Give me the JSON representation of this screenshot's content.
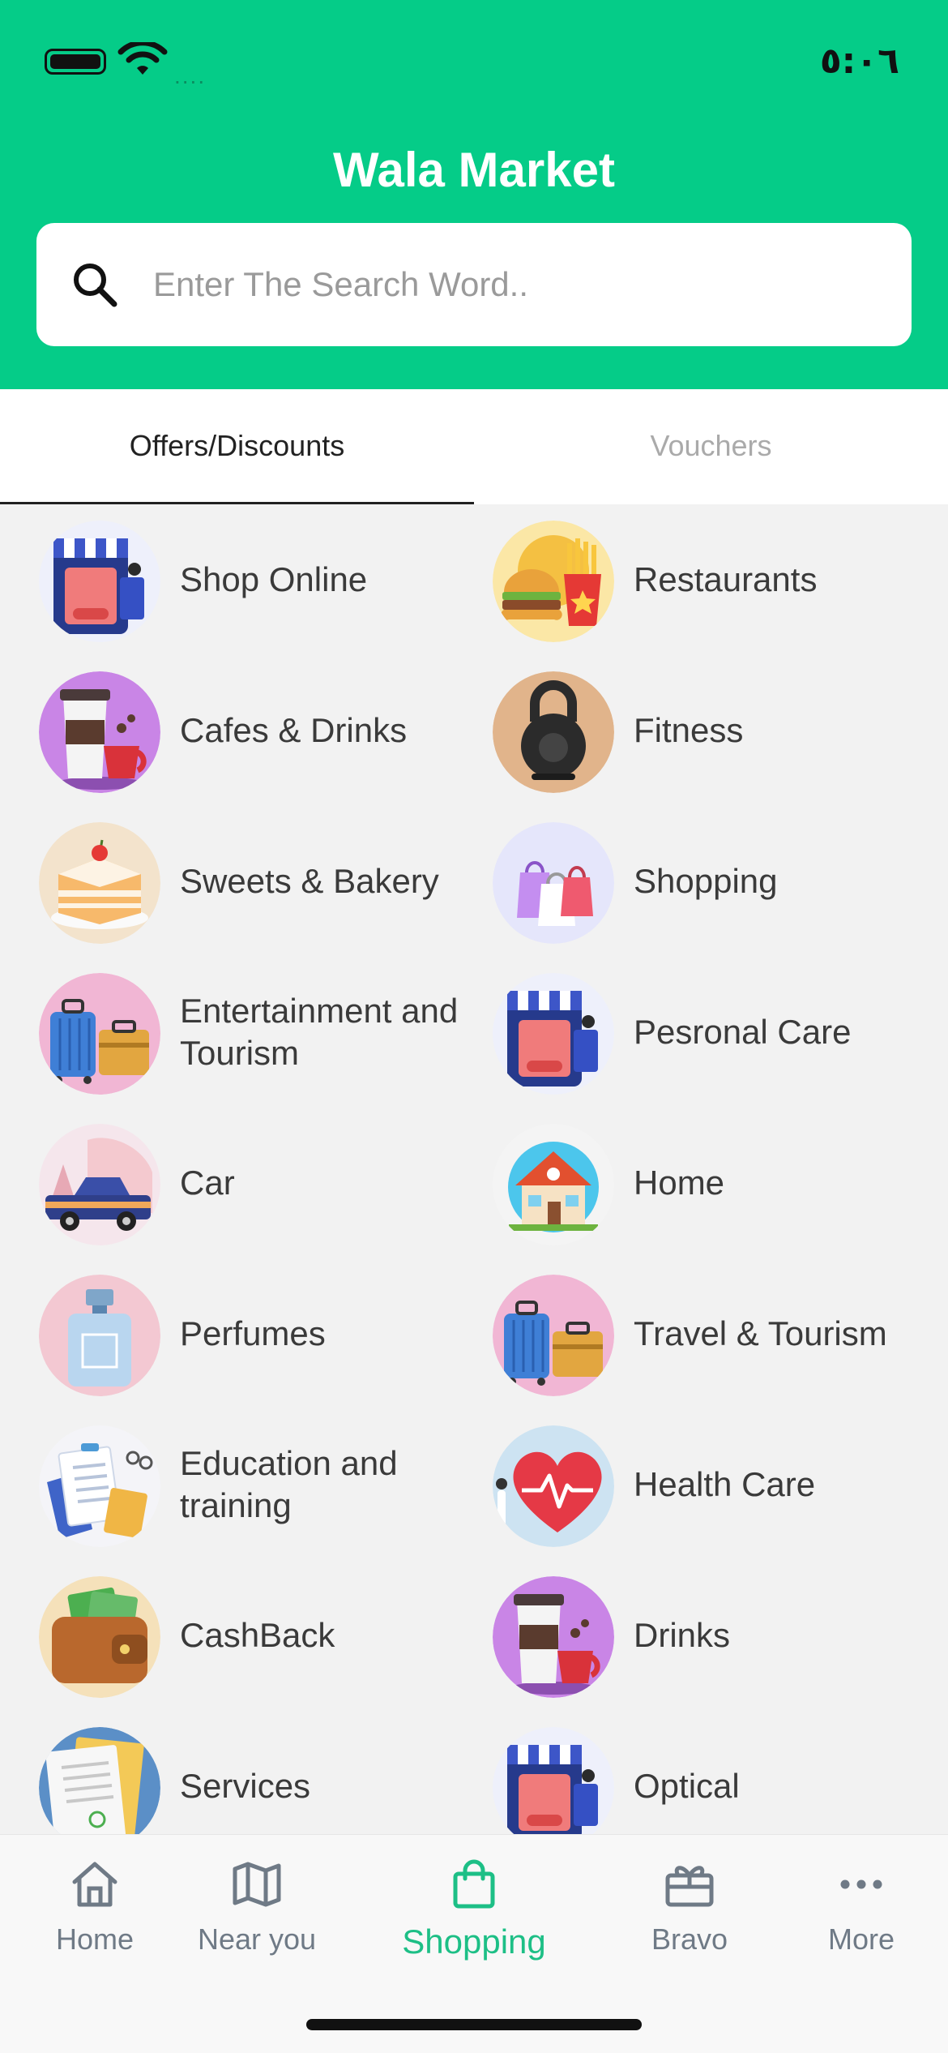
{
  "status": {
    "time": "٥:٠٦",
    "signal": "...."
  },
  "app_title": "Wala Market",
  "search": {
    "placeholder": "Enter The Search Word.."
  },
  "tabs": [
    {
      "label": "Offers/Discounts",
      "active": true
    },
    {
      "label": "Vouchers",
      "active": false
    }
  ],
  "categories": [
    {
      "label": "Shop Online",
      "icon": "store-icon"
    },
    {
      "label": "Restaurants",
      "icon": "burger-fries-icon"
    },
    {
      "label": "Cafes & Drinks",
      "icon": "coffee-cups-icon"
    },
    {
      "label": "Fitness",
      "icon": "kettlebell-icon"
    },
    {
      "label": "Sweets & Bakery",
      "icon": "cake-icon"
    },
    {
      "label": "Shopping",
      "icon": "shopping-bags-icon"
    },
    {
      "label": "Entertainment and\n Tourism",
      "icon": "luggage-icon"
    },
    {
      "label": "Pesronal Care",
      "icon": "store-icon"
    },
    {
      "label": "Car",
      "icon": "car-icon"
    },
    {
      "label": "Home",
      "icon": "house-icon"
    },
    {
      "label": "Perfumes",
      "icon": "perfume-icon"
    },
    {
      "label": "Travel & Tourism",
      "icon": "luggage-icon"
    },
    {
      "label": "Education and\ntraining",
      "icon": "documents-icon"
    },
    {
      "label": "Health Care",
      "icon": "heart-icon"
    },
    {
      "label": "CashBack",
      "icon": "wallet-icon"
    },
    {
      "label": "Drinks",
      "icon": "coffee-cups-icon"
    },
    {
      "label": "Services",
      "icon": "papers-icon"
    },
    {
      "label": "Optical",
      "icon": "store-icon"
    }
  ],
  "nav": [
    {
      "label": "Home",
      "icon": "house-outline-icon"
    },
    {
      "label": "Near you",
      "icon": "map-icon"
    },
    {
      "label": "Shopping",
      "icon": "bag-icon",
      "active": true
    },
    {
      "label": "Bravo",
      "icon": "gift-icon"
    },
    {
      "label": "More",
      "icon": "more-dots-icon"
    }
  ],
  "colors": {
    "brand": "#05cc88",
    "active_nav": "#1dbf86",
    "inactive_nav": "#6f7a86"
  }
}
